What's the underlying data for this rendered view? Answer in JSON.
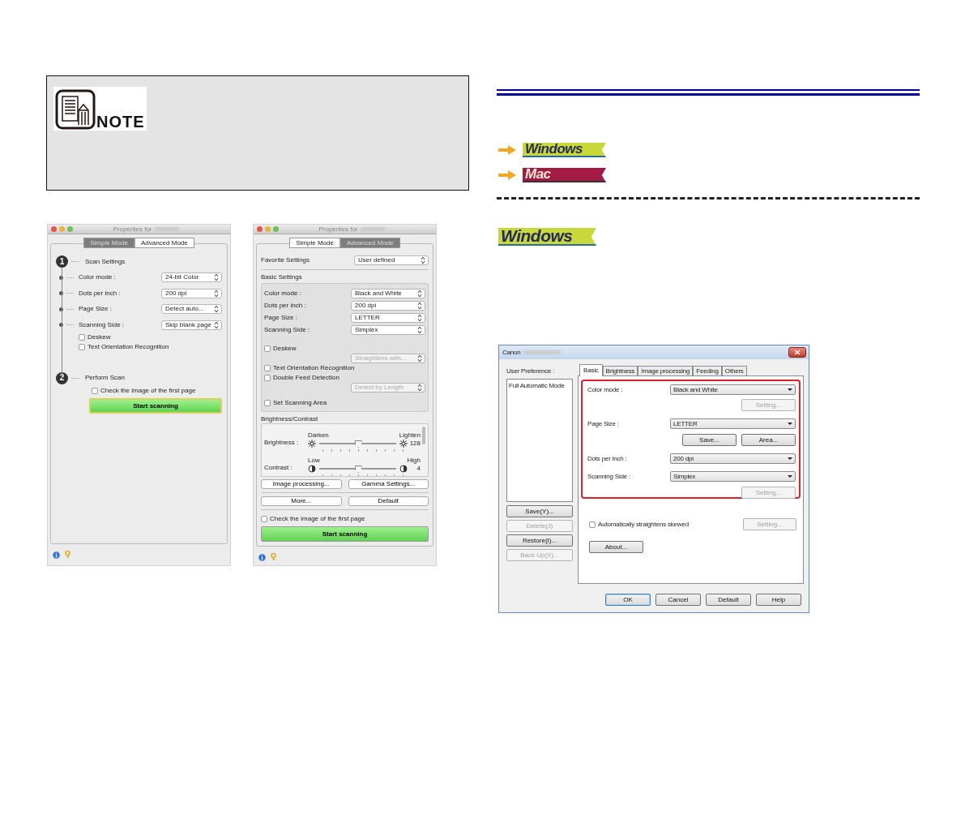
{
  "note": {
    "label": "NOTE"
  },
  "os_links": [
    {
      "kind": "windows",
      "label": "Windows"
    },
    {
      "kind": "mac",
      "label": "Mac"
    }
  ],
  "section_badge": {
    "kind": "windows",
    "label": "Windows"
  },
  "mac_simple_window": {
    "title": "Properties for",
    "tabs": [
      {
        "label": "Simple Mode",
        "selected": true
      },
      {
        "label": "Advanced Mode",
        "selected": false
      }
    ],
    "steps": [
      {
        "number": "1",
        "label": "Scan Settings"
      },
      {
        "number": "2",
        "label": "Perform Scan"
      }
    ],
    "settings": [
      {
        "label": "Color mode :",
        "value": "24-bit Color"
      },
      {
        "label": "Dots per inch :",
        "value": "200 dpi"
      },
      {
        "label": "Page Size :",
        "value": "Detect auto..."
      },
      {
        "label": "Scanning Side :",
        "value": "Skip blank page"
      }
    ],
    "checkboxes": [
      {
        "label": "Deskew",
        "checked": false
      },
      {
        "label": "Text Orientation Recognition",
        "checked": false
      }
    ],
    "first_page_check": {
      "label": "Check the image of the first page",
      "checked": false
    },
    "start_button": "Start scanning"
  },
  "mac_advanced_window": {
    "title": "Properties for",
    "tabs": [
      {
        "label": "Simple Mode",
        "selected": false
      },
      {
        "label": "Advanced Mode",
        "selected": true
      }
    ],
    "favorite": {
      "label": "Favorite Settings",
      "value": "User defined"
    },
    "basic_heading": "Basic Settings",
    "settings": [
      {
        "label": "Color mode :",
        "value": "Black and White"
      },
      {
        "label": "Dots per inch :",
        "value": "200 dpi"
      },
      {
        "label": "Page Size :",
        "value": "LETTER"
      },
      {
        "label": "Scanning Side :",
        "value": "Simplex"
      }
    ],
    "options": [
      {
        "kind": "checkbox",
        "label": "Deskew",
        "checked": false
      },
      {
        "kind": "select",
        "value": "Straightens with...",
        "disabled": true
      },
      {
        "kind": "checkbox",
        "label": "Text Orientation Recognition",
        "checked": false
      },
      {
        "kind": "checkbox",
        "label": "Double Feed Detection",
        "checked": false
      },
      {
        "kind": "select",
        "value": "Detect by Length",
        "disabled": true
      },
      {
        "kind": "checkbox",
        "label": "Set Scanning Area",
        "checked": false
      }
    ],
    "brightness_heading": "Brightness/Contrast",
    "sliders": [
      {
        "kind": "sun",
        "label": "Brightness :",
        "low": "Darken",
        "high": "Lighten",
        "value": "128",
        "level": 0.5
      },
      {
        "kind": "contrast",
        "label": "Contrast :",
        "low": "Low",
        "high": "High",
        "value": "4",
        "level": 0.5
      }
    ],
    "buttons": [
      "Image processing...",
      "Gamma Settings...",
      "More...",
      "Default"
    ],
    "first_page_check": {
      "label": "Check the image of the first page",
      "checked": false
    },
    "start_button": "Start scanning"
  },
  "windows_dialog": {
    "title": "Canon",
    "user_preference_label": "User Preference :",
    "preferences": [
      {
        "label": "Full Automatic Mode",
        "selected": false
      }
    ],
    "side_buttons": [
      {
        "label": "Save(Y)...",
        "disabled": false
      },
      {
        "label": "Delete(J)",
        "disabled": true
      },
      {
        "label": "Restore(I)...",
        "disabled": false
      },
      {
        "label": "Back Up(X)...",
        "disabled": true
      }
    ],
    "tabs": [
      {
        "label": "Basic",
        "selected": true
      },
      {
        "label": "Brightness",
        "selected": false
      },
      {
        "label": "Image processing",
        "selected": false
      },
      {
        "label": "Feeding",
        "selected": false
      },
      {
        "label": "Others",
        "selected": false
      }
    ],
    "basic_rows": [
      {
        "kind": "select",
        "label": "Color mode :",
        "value": "Black and White"
      },
      {
        "kind": "buttons",
        "buttons": [
          {
            "label": "Setting...",
            "disabled": true
          }
        ]
      },
      {
        "kind": "select",
        "label": "Page Size :",
        "value": "LETTER"
      },
      {
        "kind": "buttons",
        "buttons": [
          {
            "label": "Save...",
            "disabled": false
          },
          {
            "label": "Area...",
            "disabled": false
          }
        ]
      },
      {
        "kind": "select",
        "label": "Dots per inch :",
        "value": "200 dpi"
      },
      {
        "kind": "select",
        "label": "Scanning Side :",
        "value": "Simplex"
      },
      {
        "kind": "buttons",
        "buttons": [
          {
            "label": "Setting...",
            "disabled": true
          }
        ]
      }
    ],
    "straighten": {
      "label": "Automatically straightens skewed",
      "checked": false,
      "button": "Setting...",
      "button_disabled": true
    },
    "about_button": "About...",
    "footer_buttons": [
      {
        "label": "OK",
        "selected": true
      },
      {
        "label": "Cancel",
        "selected": false
      },
      {
        "label": "Default",
        "selected": false
      },
      {
        "label": "Help",
        "selected": false
      }
    ]
  }
}
